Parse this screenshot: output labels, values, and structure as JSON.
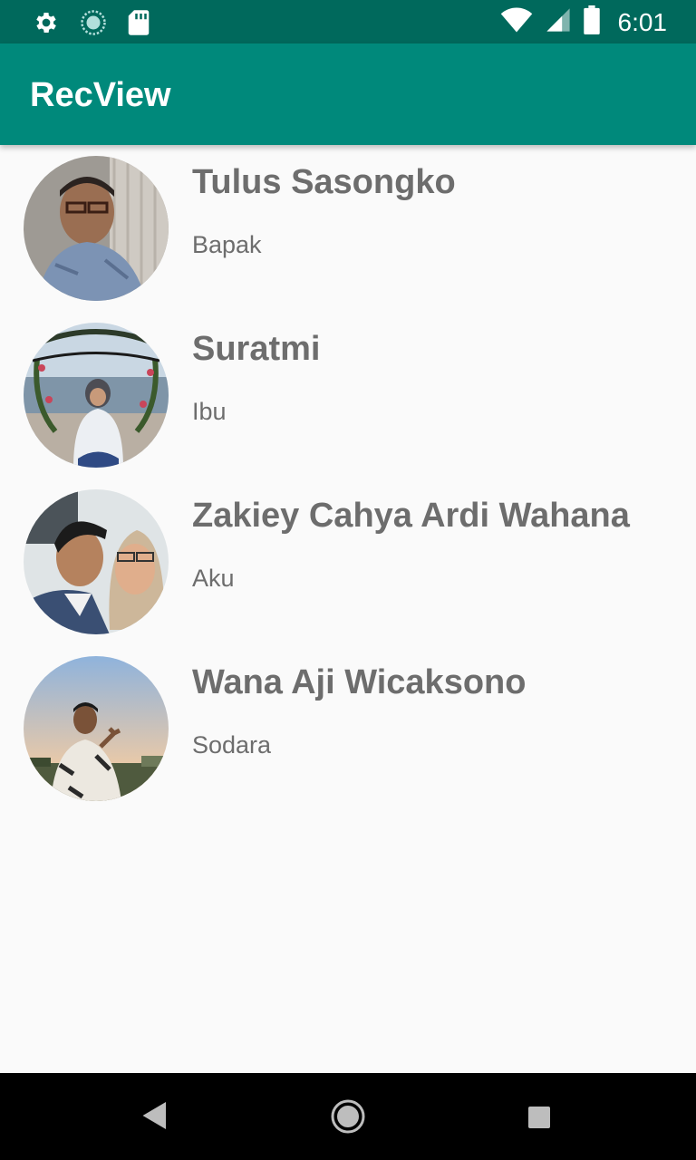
{
  "status_bar": {
    "time": "6:01",
    "left_icons": [
      "gear-icon",
      "sync-icon",
      "sd-card-icon"
    ],
    "right_icons": [
      "wifi-icon",
      "signal-icon",
      "battery-icon"
    ]
  },
  "app_bar": {
    "title": "RecView",
    "color": "#00897b",
    "status_color": "#00695c"
  },
  "contacts": [
    {
      "name": "Tulus Sasongko",
      "relation": "Bapak"
    },
    {
      "name": "Suratmi",
      "relation": "Ibu"
    },
    {
      "name": "Zakiey Cahya Ardi Wahana",
      "relation": "Aku"
    },
    {
      "name": "Wana Aji Wicaksono",
      "relation": "Sodara"
    }
  ],
  "nav_bar": {
    "buttons": [
      "back-icon",
      "home-icon",
      "recents-icon"
    ]
  }
}
